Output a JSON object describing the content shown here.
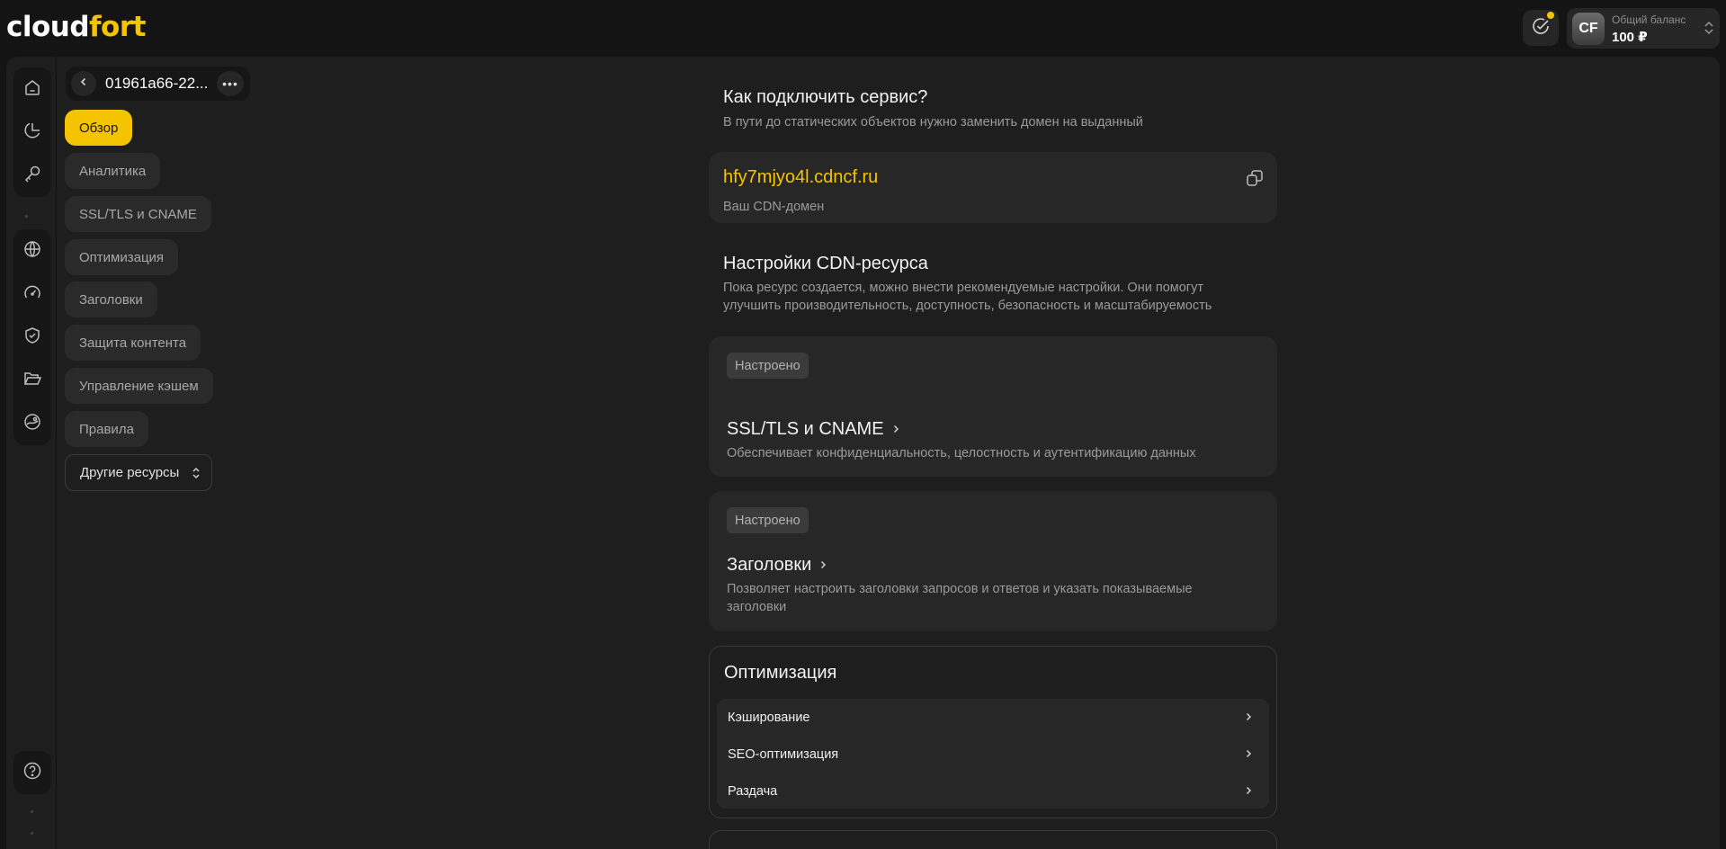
{
  "brand": {
    "logo_part1": "cloud",
    "logo_part2": "fort"
  },
  "header": {
    "avatar_initials": "CF",
    "balance_label": "Общий баланс",
    "balance_value": "100 ₽"
  },
  "rail": {
    "icons": [
      "home-icon",
      "analytics-pie-icon",
      "key-icon",
      "globe-icon",
      "speedometer-icon",
      "shield-check-icon",
      "folder-open-icon",
      "storage-icon",
      "help-icon"
    ]
  },
  "resource": {
    "name": "01961a66-22...",
    "more": "•••"
  },
  "nav": {
    "items": [
      {
        "label": "Обзор",
        "active": true
      },
      {
        "label": "Аналитика",
        "active": false
      },
      {
        "label": "SSL/TLS и CNAME",
        "active": false
      },
      {
        "label": "Оптимизация",
        "active": false
      },
      {
        "label": "Заголовки",
        "active": false
      },
      {
        "label": "Защита контента",
        "active": false
      },
      {
        "label": "Управление кэшем",
        "active": false
      },
      {
        "label": "Правила",
        "active": false
      }
    ],
    "other_resources": "Другие ресурсы"
  },
  "connect": {
    "title": "Как подключить сервис?",
    "subtitle": "В пути до статических объектов нужно заменить домен на выданный",
    "cdn_domain": "hfy7mjyo4l.cdncf.ru",
    "cdn_domain_label": "Ваш CDN-домен"
  },
  "settings": {
    "title": "Настройки CDN-ресурса",
    "subtitle_line1": "Пока ресурс создается, можно внести рекомендуемые настройки. Они помогут",
    "subtitle_line2": "улучшить производительность, доступность, безопасность и масштабируемость",
    "cards": [
      {
        "badge": "Настроено",
        "title": "SSL/TLS и CNAME",
        "desc": "Обеспечивает конфиденциальность, целостность и аутентификацию данных"
      },
      {
        "badge": "Настроено",
        "title": "Заголовки",
        "desc": "Позволяет настроить заголовки запросов и ответов и указать показываемые заголовки"
      }
    ]
  },
  "optimization": {
    "title": "Оптимизация",
    "rows": [
      "Кэширование",
      "SEO-оптимизация",
      "Раздача"
    ]
  },
  "colors": {
    "accent": "#f5c400",
    "background": "#141414",
    "panel": "#1e1e1f",
    "card": "#272727"
  }
}
